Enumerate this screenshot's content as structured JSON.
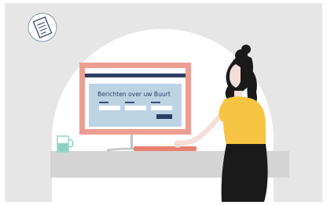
{
  "screen": {
    "headline": "Berichten over uw Buurt"
  },
  "icons": {
    "badge": "document-icon"
  },
  "colors": {
    "background_panel": "#e6e6e6",
    "arch": "#ffffff",
    "desk": "#d4d4d4",
    "monitor_frame": "#ec9e92",
    "screen": "#bcd3e4",
    "screen_header": "#2d3f63",
    "keyboard": "#e9806f",
    "mug": "#8fd0c3",
    "shirt": "#f6c543",
    "hair": "#1a1a1a",
    "pants": "#1a1a1a",
    "skin": "#f6ddd7"
  }
}
